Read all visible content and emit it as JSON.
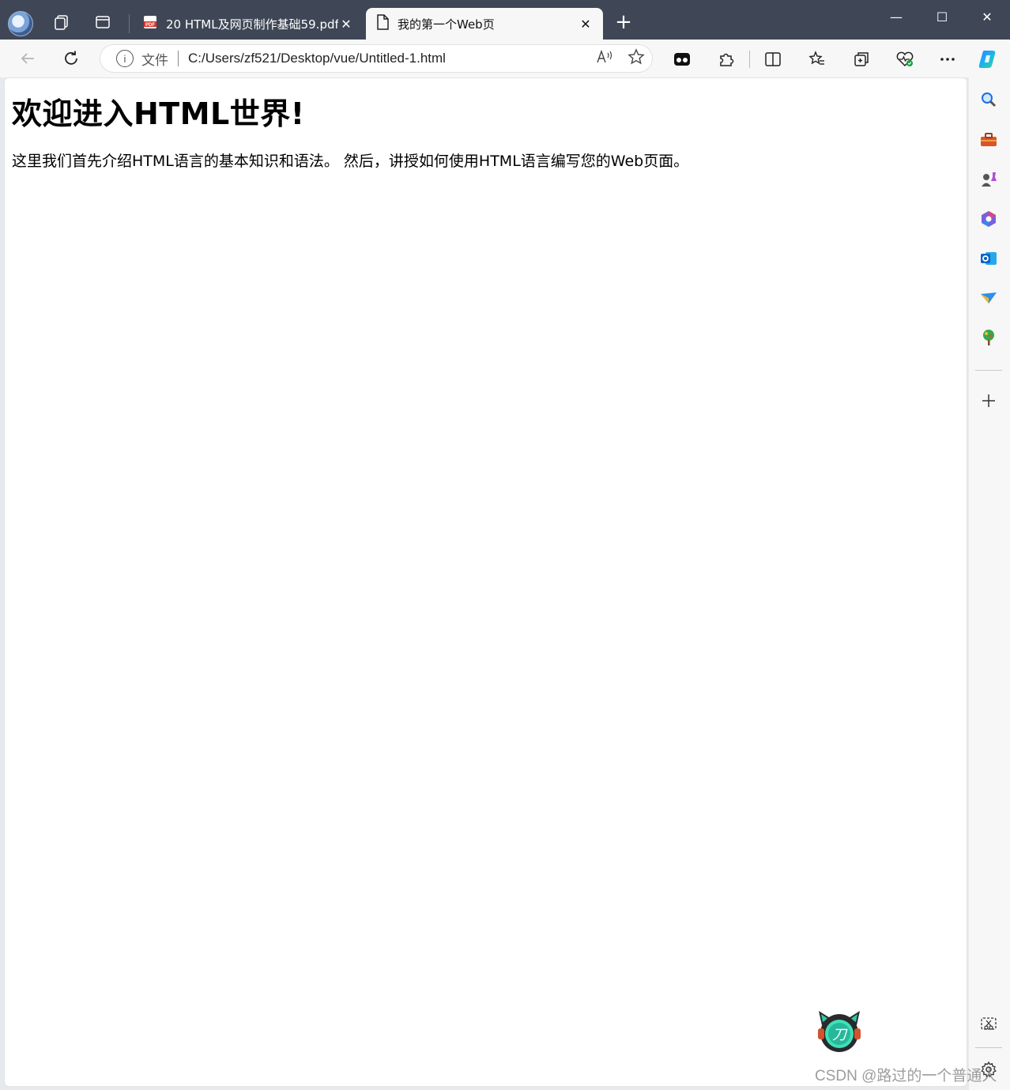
{
  "tabs": [
    {
      "title": "20 HTML及网页制作基础59.pdf",
      "icon": "pdf-icon",
      "close": "✕"
    },
    {
      "title": "我的第一个Web页",
      "icon": "page-icon",
      "close": "✕"
    }
  ],
  "new_tab_label": "+",
  "window_controls": {
    "minimize": "—",
    "maximize": "☐",
    "close": "✕"
  },
  "addressbar": {
    "info_glyph": "i",
    "scheme_label": "文件",
    "url": "C:/Users/zf521/Desktop/vue/Untitled-1.html"
  },
  "page": {
    "heading": "欢迎进入HTML世界!",
    "paragraph": "这里我们首先介绍HTML语言的基本知识和语法。 然后，讲授如何使用HTML语言编写您的Web页面。"
  },
  "watermark": "CSDN @路过的一个普通人",
  "colors": {
    "titlebar": "#3f4756",
    "toolbar": "#f7f7f7",
    "content_bg": "#ffffff"
  }
}
